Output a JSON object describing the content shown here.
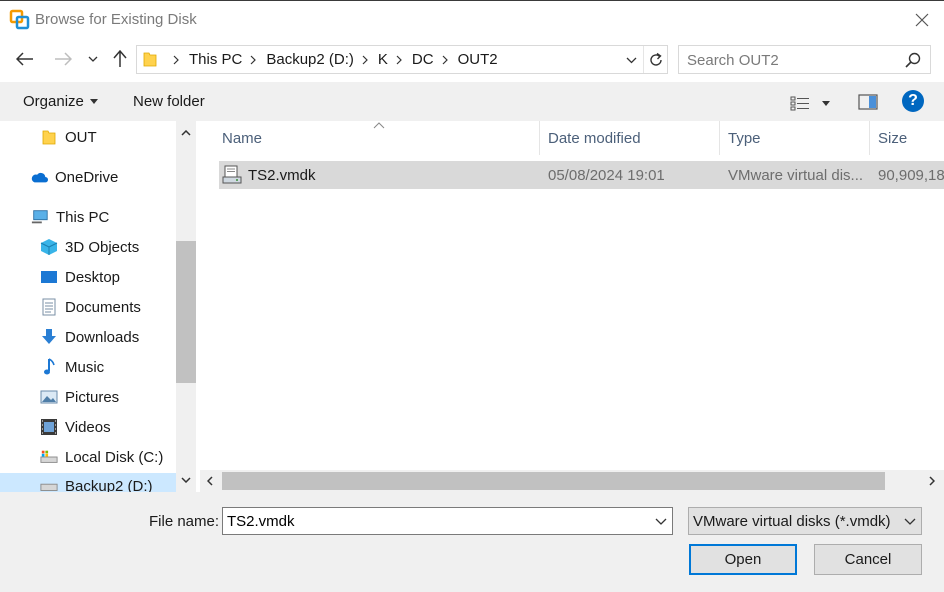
{
  "window": {
    "title": "Browse for Existing Disk",
    "app_icon": "vmware-workstation-icon",
    "close_icon": "close-icon"
  },
  "nav": {
    "back_icon": "back-arrow-icon",
    "forward_icon": "forward-arrow-icon",
    "recent_icon": "chevron-down-icon",
    "up_icon": "up-arrow-icon"
  },
  "address": {
    "crumbs": [
      "This PC",
      "Backup2 (D:)",
      "K",
      "DC",
      "OUT2"
    ],
    "refresh_icon": "refresh-icon"
  },
  "search": {
    "placeholder": "Search OUT2",
    "value": ""
  },
  "toolbar": {
    "organize_label": "Organize",
    "new_folder_label": "New folder",
    "help_label": "?"
  },
  "sidebar": {
    "items": [
      {
        "label": "OUT",
        "icon": "folder-icon"
      },
      {
        "label": "OneDrive",
        "icon": "onedrive-cloud-icon"
      },
      {
        "label": "This PC",
        "icon": "computer-icon"
      },
      {
        "label": "3D Objects",
        "icon": "3d-objects-icon"
      },
      {
        "label": "Desktop",
        "icon": "desktop-icon"
      },
      {
        "label": "Documents",
        "icon": "documents-icon"
      },
      {
        "label": "Downloads",
        "icon": "downloads-icon"
      },
      {
        "label": "Music",
        "icon": "music-icon"
      },
      {
        "label": "Pictures",
        "icon": "pictures-icon"
      },
      {
        "label": "Videos",
        "icon": "videos-icon"
      },
      {
        "label": "Local Disk (C:)",
        "icon": "local-disk-icon"
      },
      {
        "label": "Backup2 (D:)",
        "icon": "drive-icon"
      }
    ]
  },
  "files": {
    "columns": [
      "Name",
      "Date modified",
      "Type",
      "Size"
    ],
    "rows": [
      {
        "name": "TS2.vmdk",
        "date": "05/08/2024 19:01",
        "type": "VMware virtual dis...",
        "size": "90,909,184",
        "icon": "vmdk-disk-icon"
      }
    ]
  },
  "footer": {
    "file_name_label": "File name:",
    "file_name_value": "TS2.vmdk",
    "file_type_value": "VMware virtual disks (*.vmdk)",
    "open_label": "Open",
    "cancel_label": "Cancel"
  },
  "colors": {
    "selection": "#d9d9d9",
    "accent": "#0067c0",
    "chrome": "#f0f0f0"
  }
}
